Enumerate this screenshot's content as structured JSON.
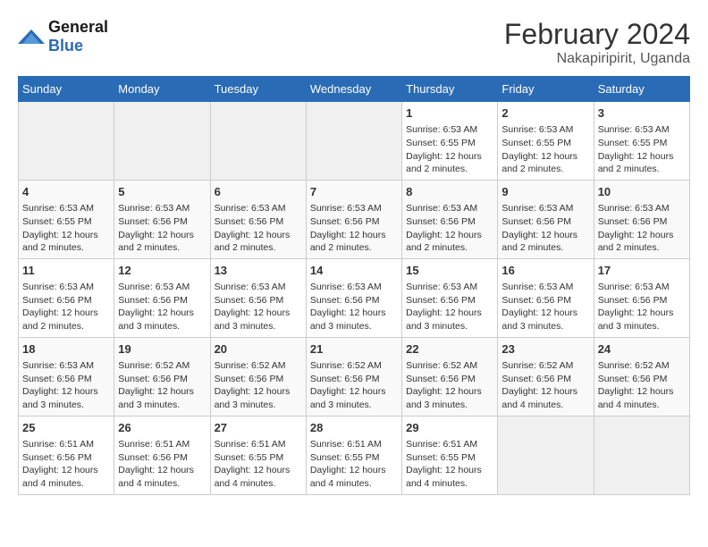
{
  "header": {
    "logo_general": "General",
    "logo_blue": "Blue",
    "month_year": "February 2024",
    "location": "Nakapiripirit, Uganda"
  },
  "days_of_week": [
    "Sunday",
    "Monday",
    "Tuesday",
    "Wednesday",
    "Thursday",
    "Friday",
    "Saturday"
  ],
  "weeks": [
    [
      {
        "day": "",
        "info": ""
      },
      {
        "day": "",
        "info": ""
      },
      {
        "day": "",
        "info": ""
      },
      {
        "day": "",
        "info": ""
      },
      {
        "day": "1",
        "info": "Sunrise: 6:53 AM\nSunset: 6:55 PM\nDaylight: 12 hours\nand 2 minutes."
      },
      {
        "day": "2",
        "info": "Sunrise: 6:53 AM\nSunset: 6:55 PM\nDaylight: 12 hours\nand 2 minutes."
      },
      {
        "day": "3",
        "info": "Sunrise: 6:53 AM\nSunset: 6:55 PM\nDaylight: 12 hours\nand 2 minutes."
      }
    ],
    [
      {
        "day": "4",
        "info": "Sunrise: 6:53 AM\nSunset: 6:55 PM\nDaylight: 12 hours\nand 2 minutes."
      },
      {
        "day": "5",
        "info": "Sunrise: 6:53 AM\nSunset: 6:56 PM\nDaylight: 12 hours\nand 2 minutes."
      },
      {
        "day": "6",
        "info": "Sunrise: 6:53 AM\nSunset: 6:56 PM\nDaylight: 12 hours\nand 2 minutes."
      },
      {
        "day": "7",
        "info": "Sunrise: 6:53 AM\nSunset: 6:56 PM\nDaylight: 12 hours\nand 2 minutes."
      },
      {
        "day": "8",
        "info": "Sunrise: 6:53 AM\nSunset: 6:56 PM\nDaylight: 12 hours\nand 2 minutes."
      },
      {
        "day": "9",
        "info": "Sunrise: 6:53 AM\nSunset: 6:56 PM\nDaylight: 12 hours\nand 2 minutes."
      },
      {
        "day": "10",
        "info": "Sunrise: 6:53 AM\nSunset: 6:56 PM\nDaylight: 12 hours\nand 2 minutes."
      }
    ],
    [
      {
        "day": "11",
        "info": "Sunrise: 6:53 AM\nSunset: 6:56 PM\nDaylight: 12 hours\nand 2 minutes."
      },
      {
        "day": "12",
        "info": "Sunrise: 6:53 AM\nSunset: 6:56 PM\nDaylight: 12 hours\nand 3 minutes."
      },
      {
        "day": "13",
        "info": "Sunrise: 6:53 AM\nSunset: 6:56 PM\nDaylight: 12 hours\nand 3 minutes."
      },
      {
        "day": "14",
        "info": "Sunrise: 6:53 AM\nSunset: 6:56 PM\nDaylight: 12 hours\nand 3 minutes."
      },
      {
        "day": "15",
        "info": "Sunrise: 6:53 AM\nSunset: 6:56 PM\nDaylight: 12 hours\nand 3 minutes."
      },
      {
        "day": "16",
        "info": "Sunrise: 6:53 AM\nSunset: 6:56 PM\nDaylight: 12 hours\nand 3 minutes."
      },
      {
        "day": "17",
        "info": "Sunrise: 6:53 AM\nSunset: 6:56 PM\nDaylight: 12 hours\nand 3 minutes."
      }
    ],
    [
      {
        "day": "18",
        "info": "Sunrise: 6:53 AM\nSunset: 6:56 PM\nDaylight: 12 hours\nand 3 minutes."
      },
      {
        "day": "19",
        "info": "Sunrise: 6:52 AM\nSunset: 6:56 PM\nDaylight: 12 hours\nand 3 minutes."
      },
      {
        "day": "20",
        "info": "Sunrise: 6:52 AM\nSunset: 6:56 PM\nDaylight: 12 hours\nand 3 minutes."
      },
      {
        "day": "21",
        "info": "Sunrise: 6:52 AM\nSunset: 6:56 PM\nDaylight: 12 hours\nand 3 minutes."
      },
      {
        "day": "22",
        "info": "Sunrise: 6:52 AM\nSunset: 6:56 PM\nDaylight: 12 hours\nand 3 minutes."
      },
      {
        "day": "23",
        "info": "Sunrise: 6:52 AM\nSunset: 6:56 PM\nDaylight: 12 hours\nand 4 minutes."
      },
      {
        "day": "24",
        "info": "Sunrise: 6:52 AM\nSunset: 6:56 PM\nDaylight: 12 hours\nand 4 minutes."
      }
    ],
    [
      {
        "day": "25",
        "info": "Sunrise: 6:51 AM\nSunset: 6:56 PM\nDaylight: 12 hours\nand 4 minutes."
      },
      {
        "day": "26",
        "info": "Sunrise: 6:51 AM\nSunset: 6:56 PM\nDaylight: 12 hours\nand 4 minutes."
      },
      {
        "day": "27",
        "info": "Sunrise: 6:51 AM\nSunset: 6:55 PM\nDaylight: 12 hours\nand 4 minutes."
      },
      {
        "day": "28",
        "info": "Sunrise: 6:51 AM\nSunset: 6:55 PM\nDaylight: 12 hours\nand 4 minutes."
      },
      {
        "day": "29",
        "info": "Sunrise: 6:51 AM\nSunset: 6:55 PM\nDaylight: 12 hours\nand 4 minutes."
      },
      {
        "day": "",
        "info": ""
      },
      {
        "day": "",
        "info": ""
      }
    ]
  ]
}
